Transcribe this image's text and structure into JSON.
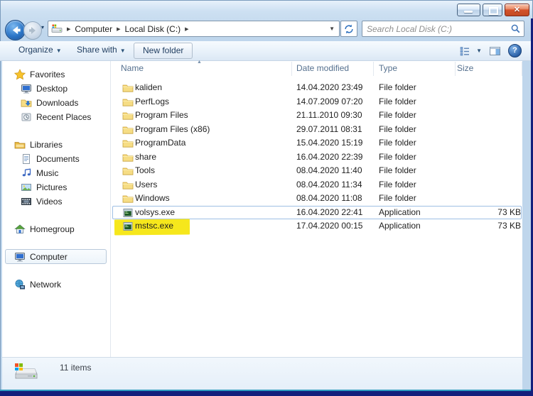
{
  "window": {
    "controls": {
      "minimize_label": "minimize",
      "maximize_label": "maximize",
      "close_label": "close"
    }
  },
  "address_bar": {
    "breadcrumbs": [
      "Computer",
      "Local Disk (C:)"
    ]
  },
  "search": {
    "placeholder": "Search Local Disk (C:)"
  },
  "toolbar": {
    "organize_label": "Organize",
    "share_with_label": "Share with",
    "new_folder_label": "New folder"
  },
  "sidebar": {
    "groups": [
      {
        "label": "Favorites",
        "icon": "star",
        "children": [
          {
            "label": "Desktop",
            "icon": "desktop"
          },
          {
            "label": "Downloads",
            "icon": "downloads"
          },
          {
            "label": "Recent Places",
            "icon": "recent"
          }
        ]
      },
      {
        "label": "Libraries",
        "icon": "libraries",
        "children": [
          {
            "label": "Documents",
            "icon": "documents"
          },
          {
            "label": "Music",
            "icon": "music"
          },
          {
            "label": "Pictures",
            "icon": "pictures"
          },
          {
            "label": "Videos",
            "icon": "videos"
          }
        ]
      },
      {
        "label": "Homegroup",
        "icon": "homegroup",
        "children": []
      },
      {
        "label": "Computer",
        "icon": "computer",
        "selected": true,
        "children": []
      },
      {
        "label": "Network",
        "icon": "network",
        "children": []
      }
    ]
  },
  "file_list": {
    "columns": [
      {
        "label": "Name",
        "sorted": "asc"
      },
      {
        "label": "Date modified"
      },
      {
        "label": "Type"
      },
      {
        "label": "Size"
      }
    ],
    "rows": [
      {
        "name": "kaliden",
        "date": "14.04.2020 23:49",
        "type": "File folder",
        "size": "",
        "icon": "folder"
      },
      {
        "name": "PerfLogs",
        "date": "14.07.2009 07:20",
        "type": "File folder",
        "size": "",
        "icon": "folder"
      },
      {
        "name": "Program Files",
        "date": "21.11.2010 09:30",
        "type": "File folder",
        "size": "",
        "icon": "folder"
      },
      {
        "name": "Program Files (x86)",
        "date": "29.07.2011 08:31",
        "type": "File folder",
        "size": "",
        "icon": "folder"
      },
      {
        "name": "ProgramData",
        "date": "15.04.2020 15:19",
        "type": "File folder",
        "size": "",
        "icon": "folder"
      },
      {
        "name": "share",
        "date": "16.04.2020 22:39",
        "type": "File folder",
        "size": "",
        "icon": "folder"
      },
      {
        "name": "Tools",
        "date": "08.04.2020 11:40",
        "type": "File folder",
        "size": "",
        "icon": "folder"
      },
      {
        "name": "Users",
        "date": "08.04.2020 11:34",
        "type": "File folder",
        "size": "",
        "icon": "folder"
      },
      {
        "name": "Windows",
        "date": "08.04.2020 11:08",
        "type": "File folder",
        "size": "",
        "icon": "folder"
      },
      {
        "name": "volsys.exe",
        "date": "16.04.2020 22:41",
        "type": "Application",
        "size": "73 KB",
        "icon": "application",
        "selected": true
      },
      {
        "name": "mstsc.exe",
        "date": "17.04.2020 00:15",
        "type": "Application",
        "size": "73 KB",
        "icon": "application",
        "highlighted": true
      }
    ]
  },
  "status_bar": {
    "items_count": "11 items"
  },
  "colors": {
    "annotation_highlight": "#f6e71c",
    "selection_border": "#9ebfe4",
    "window_chrome": "#bfd6ec",
    "outer_border_navy": "#131f7c",
    "folder_yellow": "#f6dd85"
  }
}
